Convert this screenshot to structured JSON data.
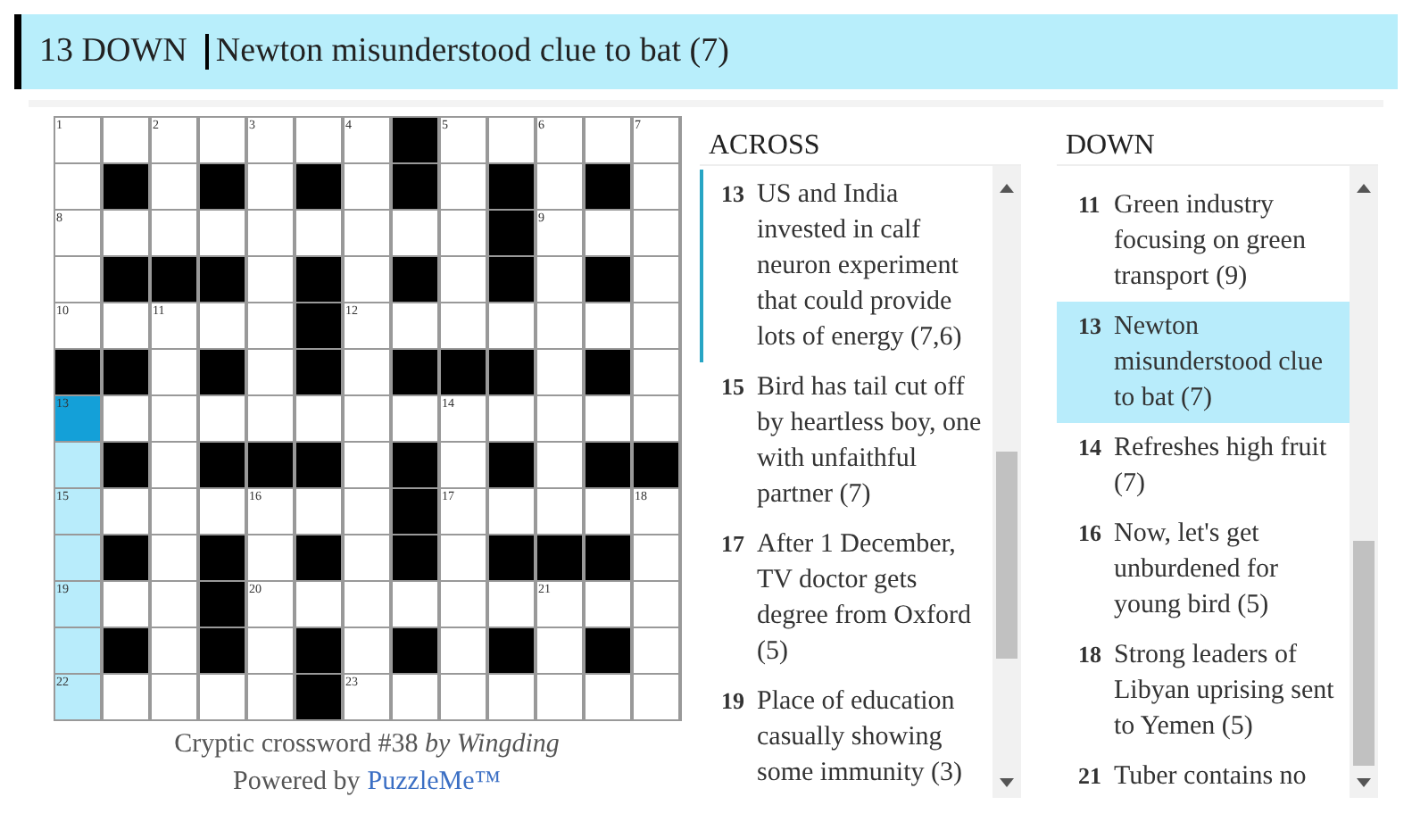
{
  "current_clue": {
    "label": "13 DOWN",
    "text": "Newton misunderstood clue to bat (7)"
  },
  "grid": {
    "rows": [
      [
        {
          "block": false,
          "number": "1",
          "selected": false,
          "highlighted": false
        },
        {
          "block": false,
          "selected": false,
          "highlighted": false
        },
        {
          "block": false,
          "number": "2",
          "selected": false,
          "highlighted": false
        },
        {
          "block": false,
          "selected": false,
          "highlighted": false
        },
        {
          "block": false,
          "number": "3",
          "selected": false,
          "highlighted": false
        },
        {
          "block": false,
          "selected": false,
          "highlighted": false
        },
        {
          "block": false,
          "number": "4",
          "selected": false,
          "highlighted": false
        },
        {
          "block": true
        },
        {
          "block": false,
          "number": "5",
          "selected": false,
          "highlighted": false
        },
        {
          "block": false,
          "selected": false,
          "highlighted": false
        },
        {
          "block": false,
          "number": "6",
          "selected": false,
          "highlighted": false
        },
        {
          "block": false,
          "selected": false,
          "highlighted": false
        },
        {
          "block": false,
          "number": "7",
          "selected": false,
          "highlighted": false
        }
      ],
      [
        {
          "block": false,
          "selected": false,
          "highlighted": false
        },
        {
          "block": true
        },
        {
          "block": false,
          "selected": false,
          "highlighted": false
        },
        {
          "block": true
        },
        {
          "block": false,
          "selected": false,
          "highlighted": false
        },
        {
          "block": true
        },
        {
          "block": false,
          "selected": false,
          "highlighted": false
        },
        {
          "block": true
        },
        {
          "block": false,
          "selected": false,
          "highlighted": false
        },
        {
          "block": true
        },
        {
          "block": false,
          "selected": false,
          "highlighted": false
        },
        {
          "block": true
        },
        {
          "block": false,
          "selected": false,
          "highlighted": false
        }
      ],
      [
        {
          "block": false,
          "number": "8",
          "selected": false,
          "highlighted": false
        },
        {
          "block": false,
          "selected": false,
          "highlighted": false
        },
        {
          "block": false,
          "selected": false,
          "highlighted": false
        },
        {
          "block": false,
          "selected": false,
          "highlighted": false
        },
        {
          "block": false,
          "selected": false,
          "highlighted": false
        },
        {
          "block": false,
          "selected": false,
          "highlighted": false
        },
        {
          "block": false,
          "selected": false,
          "highlighted": false
        },
        {
          "block": false,
          "selected": false,
          "highlighted": false
        },
        {
          "block": false,
          "selected": false,
          "highlighted": false
        },
        {
          "block": true
        },
        {
          "block": false,
          "number": "9",
          "selected": false,
          "highlighted": false
        },
        {
          "block": false,
          "selected": false,
          "highlighted": false
        },
        {
          "block": false,
          "selected": false,
          "highlighted": false
        }
      ],
      [
        {
          "block": false,
          "selected": false,
          "highlighted": false
        },
        {
          "block": true
        },
        {
          "block": true
        },
        {
          "block": true
        },
        {
          "block": false,
          "selected": false,
          "highlighted": false
        },
        {
          "block": true
        },
        {
          "block": false,
          "selected": false,
          "highlighted": false
        },
        {
          "block": true
        },
        {
          "block": false,
          "selected": false,
          "highlighted": false
        },
        {
          "block": true
        },
        {
          "block": false,
          "selected": false,
          "highlighted": false
        },
        {
          "block": true
        },
        {
          "block": false,
          "selected": false,
          "highlighted": false
        }
      ],
      [
        {
          "block": false,
          "number": "10",
          "selected": false,
          "highlighted": false
        },
        {
          "block": false,
          "selected": false,
          "highlighted": false
        },
        {
          "block": false,
          "number": "11",
          "selected": false,
          "highlighted": false
        },
        {
          "block": false,
          "selected": false,
          "highlighted": false
        },
        {
          "block": false,
          "selected": false,
          "highlighted": false
        },
        {
          "block": true
        },
        {
          "block": false,
          "number": "12",
          "selected": false,
          "highlighted": false
        },
        {
          "block": false,
          "selected": false,
          "highlighted": false
        },
        {
          "block": false,
          "selected": false,
          "highlighted": false
        },
        {
          "block": false,
          "selected": false,
          "highlighted": false
        },
        {
          "block": false,
          "selected": false,
          "highlighted": false
        },
        {
          "block": false,
          "selected": false,
          "highlighted": false
        },
        {
          "block": false,
          "selected": false,
          "highlighted": false
        }
      ],
      [
        {
          "block": true
        },
        {
          "block": true
        },
        {
          "block": false,
          "selected": false,
          "highlighted": false
        },
        {
          "block": true
        },
        {
          "block": false,
          "selected": false,
          "highlighted": false
        },
        {
          "block": true
        },
        {
          "block": false,
          "selected": false,
          "highlighted": false
        },
        {
          "block": true
        },
        {
          "block": true
        },
        {
          "block": true
        },
        {
          "block": false,
          "selected": false,
          "highlighted": false
        },
        {
          "block": true
        },
        {
          "block": false,
          "selected": false,
          "highlighted": false
        }
      ],
      [
        {
          "block": false,
          "number": "13",
          "selected": true
        },
        {
          "block": false,
          "selected": false,
          "highlighted": false
        },
        {
          "block": false,
          "selected": false,
          "highlighted": false
        },
        {
          "block": false,
          "selected": false,
          "highlighted": false
        },
        {
          "block": false,
          "selected": false,
          "highlighted": false
        },
        {
          "block": false,
          "selected": false,
          "highlighted": false
        },
        {
          "block": false,
          "selected": false,
          "highlighted": false
        },
        {
          "block": false,
          "selected": false,
          "highlighted": false
        },
        {
          "block": false,
          "number": "14",
          "selected": false,
          "highlighted": false
        },
        {
          "block": false,
          "selected": false,
          "highlighted": false
        },
        {
          "block": false,
          "selected": false,
          "highlighted": false
        },
        {
          "block": false,
          "selected": false,
          "highlighted": false
        },
        {
          "block": false,
          "selected": false,
          "highlighted": false
        }
      ],
      [
        {
          "block": false,
          "selected": false,
          "highlighted": true
        },
        {
          "block": true
        },
        {
          "block": false,
          "selected": false,
          "highlighted": false
        },
        {
          "block": true
        },
        {
          "block": true
        },
        {
          "block": true
        },
        {
          "block": false,
          "selected": false,
          "highlighted": false
        },
        {
          "block": true
        },
        {
          "block": false,
          "selected": false,
          "highlighted": false
        },
        {
          "block": true
        },
        {
          "block": false,
          "selected": false,
          "highlighted": false
        },
        {
          "block": true
        },
        {
          "block": true
        }
      ],
      [
        {
          "block": false,
          "number": "15",
          "selected": false,
          "highlighted": true
        },
        {
          "block": false,
          "selected": false,
          "highlighted": false
        },
        {
          "block": false,
          "selected": false,
          "highlighted": false
        },
        {
          "block": false,
          "selected": false,
          "highlighted": false
        },
        {
          "block": false,
          "number": "16",
          "selected": false,
          "highlighted": false
        },
        {
          "block": false,
          "selected": false,
          "highlighted": false
        },
        {
          "block": false,
          "selected": false,
          "highlighted": false
        },
        {
          "block": true
        },
        {
          "block": false,
          "number": "17",
          "selected": false,
          "highlighted": false
        },
        {
          "block": false,
          "selected": false,
          "highlighted": false
        },
        {
          "block": false,
          "selected": false,
          "highlighted": false
        },
        {
          "block": false,
          "selected": false,
          "highlighted": false
        },
        {
          "block": false,
          "number": "18",
          "selected": false,
          "highlighted": false
        }
      ],
      [
        {
          "block": false,
          "selected": false,
          "highlighted": true
        },
        {
          "block": true
        },
        {
          "block": false,
          "selected": false,
          "highlighted": false
        },
        {
          "block": true
        },
        {
          "block": false,
          "selected": false,
          "highlighted": false
        },
        {
          "block": true
        },
        {
          "block": false,
          "selected": false,
          "highlighted": false
        },
        {
          "block": true
        },
        {
          "block": false,
          "selected": false,
          "highlighted": false
        },
        {
          "block": true
        },
        {
          "block": true
        },
        {
          "block": true
        },
        {
          "block": false,
          "selected": false,
          "highlighted": false
        }
      ],
      [
        {
          "block": false,
          "number": "19",
          "selected": false,
          "highlighted": true
        },
        {
          "block": false,
          "selected": false,
          "highlighted": false
        },
        {
          "block": false,
          "selected": false,
          "highlighted": false
        },
        {
          "block": true
        },
        {
          "block": false,
          "number": "20",
          "selected": false,
          "highlighted": false
        },
        {
          "block": false,
          "selected": false,
          "highlighted": false
        },
        {
          "block": false,
          "selected": false,
          "highlighted": false
        },
        {
          "block": false,
          "selected": false,
          "highlighted": false
        },
        {
          "block": false,
          "selected": false,
          "highlighted": false
        },
        {
          "block": false,
          "selected": false,
          "highlighted": false
        },
        {
          "block": false,
          "number": "21",
          "selected": false,
          "highlighted": false
        },
        {
          "block": false,
          "selected": false,
          "highlighted": false
        },
        {
          "block": false,
          "selected": false,
          "highlighted": false
        }
      ],
      [
        {
          "block": false,
          "selected": false,
          "highlighted": true
        },
        {
          "block": true
        },
        {
          "block": false,
          "selected": false,
          "highlighted": false
        },
        {
          "block": true
        },
        {
          "block": false,
          "selected": false,
          "highlighted": false
        },
        {
          "block": true
        },
        {
          "block": false,
          "selected": false,
          "highlighted": false
        },
        {
          "block": true
        },
        {
          "block": false,
          "selected": false,
          "highlighted": false
        },
        {
          "block": true
        },
        {
          "block": false,
          "selected": false,
          "highlighted": false
        },
        {
          "block": true
        },
        {
          "block": false,
          "selected": false,
          "highlighted": false
        }
      ],
      [
        {
          "block": false,
          "number": "22",
          "selected": false,
          "highlighted": true
        },
        {
          "block": false,
          "selected": false,
          "highlighted": false
        },
        {
          "block": false,
          "selected": false,
          "highlighted": false
        },
        {
          "block": false,
          "selected": false,
          "highlighted": false
        },
        {
          "block": false,
          "selected": false,
          "highlighted": false
        },
        {
          "block": true
        },
        {
          "block": false,
          "number": "23",
          "selected": false,
          "highlighted": false
        },
        {
          "block": false,
          "selected": false,
          "highlighted": false
        },
        {
          "block": false,
          "selected": false,
          "highlighted": false
        },
        {
          "block": false,
          "selected": false,
          "highlighted": false
        },
        {
          "block": false,
          "selected": false,
          "highlighted": false
        },
        {
          "block": false,
          "selected": false,
          "highlighted": false
        },
        {
          "block": false,
          "selected": false,
          "highlighted": false
        }
      ]
    ]
  },
  "caption": {
    "text": "Cryptic crossword #38 *by Wingding*",
    "powered_by": "Powered by",
    "link": "PuzzleMe™"
  },
  "across": {
    "title": "ACROSS",
    "clues": [
      {
        "number": "13",
        "text": "US and India invested in calf neuron experiment that could provide lots of energy (7,6)",
        "selected": false,
        "crossing": true
      },
      {
        "number": "15",
        "text": "Bird has tail cut off by heartless boy, one with unfaithful partner (7)",
        "selected": false,
        "crossing": false
      },
      {
        "number": "17",
        "text": "After 1 December, TV doctor gets degree from Oxford (5)",
        "selected": false,
        "crossing": false
      },
      {
        "number": "19",
        "text": "Place of education casually showing some immunity (3)",
        "selected": false,
        "crossing": false
      }
    ]
  },
  "down": {
    "title": "DOWN",
    "clues": [
      {
        "number": "11",
        "text": "Green industry focusing on green transport (9)",
        "selected": false,
        "crossing": false
      },
      {
        "number": "13",
        "text": "Newton misunderstood clue to bat (7)",
        "selected": true,
        "crossing": false
      },
      {
        "number": "14",
        "text": "Refreshes high fruit (7)",
        "selected": false,
        "crossing": false
      },
      {
        "number": "16",
        "text": "Now, let's get unburdened for young bird (5)",
        "selected": false,
        "crossing": false
      },
      {
        "number": "18",
        "text": "Strong leaders of Libyan uprising sent to Yemen (5)",
        "selected": false,
        "crossing": false
      },
      {
        "number": "21",
        "text": "Tuber contains no",
        "selected": false,
        "crossing": false
      }
    ]
  }
}
